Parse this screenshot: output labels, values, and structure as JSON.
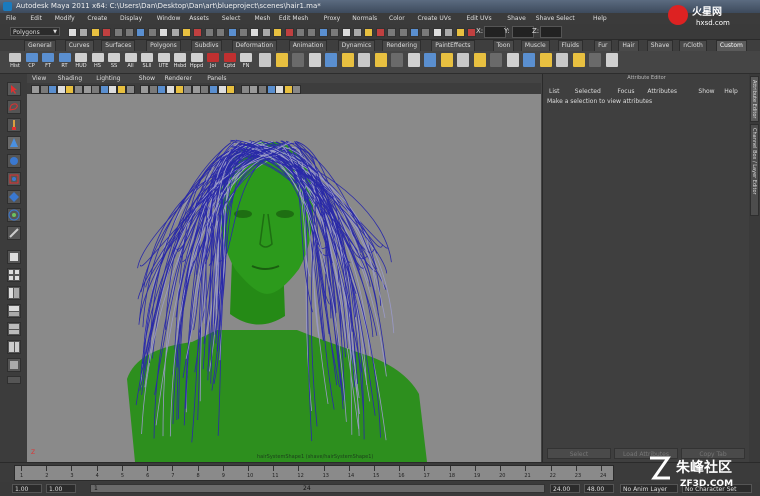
{
  "titlebar": {
    "title": "Autodesk Maya 2011 x64: C:\\Users\\Dan\\Desktop\\Dan\\art\\blueproject\\scenes\\hair1.ma*"
  },
  "menubar": [
    "File",
    "Edit",
    "Modify",
    "Create",
    "Display",
    "Window",
    "Assets",
    "Select",
    "Mesh",
    "Edit Mesh",
    "Proxy",
    "Normals",
    "Color",
    "Create UVs",
    "Edit UVs",
    "Shave",
    "Shave Select",
    "Help"
  ],
  "statusline": {
    "menuset": "Polygons",
    "coord_labels": [
      "X:",
      "Y:",
      "Z:"
    ]
  },
  "shelf_tabs": [
    "General",
    "Curves",
    "Surfaces",
    "Polygons",
    "Subdivs",
    "Deformation",
    "Animation",
    "Dynamics",
    "Rendering",
    "PaintEffects",
    "Toon",
    "Muscle",
    "Fluids",
    "Fur",
    "Hair",
    "Shave",
    "nCloth",
    "Custom"
  ],
  "shelf_tab_active": "Custom",
  "shelf_buttons": [
    {
      "label": "Hist",
      "color": "#c8c8c8"
    },
    {
      "label": "CP",
      "color": "#5a8fd0"
    },
    {
      "label": "FT",
      "color": "#5a8fd0"
    },
    {
      "label": "RT",
      "color": "#5a8fd0"
    },
    {
      "label": "HUD",
      "color": "#d0d0d0"
    },
    {
      "label": "HS",
      "color": "#d0d0d0"
    },
    {
      "label": "SS",
      "color": "#d0d0d0"
    },
    {
      "label": "All",
      "color": "#d0d0d0"
    },
    {
      "label": "SLII",
      "color": "#d0d0d0"
    },
    {
      "label": "UTE",
      "color": "#d0d0d0"
    },
    {
      "label": "Hsbd",
      "color": "#d0d0d0"
    },
    {
      "label": "Hppd",
      "color": "#d0d0d0"
    },
    {
      "label": "Joi",
      "color": "#c03030"
    },
    {
      "label": "Cptd",
      "color": "#c03030"
    },
    {
      "label": "FN",
      "color": "#d0d0d0"
    }
  ],
  "panel_menu": [
    "View",
    "Shading",
    "Lighting",
    "Show",
    "Renderer",
    "Panels"
  ],
  "viewport": {
    "bg": "#8a8a8a",
    "footer": "hairSystemShape1 (shave/hairSystemShape1)",
    "axis_label": "Z"
  },
  "attribute_editor": {
    "title": "Attribute Editor",
    "menu": [
      "List",
      "Selected",
      "Focus",
      "Attributes",
      "Show",
      "Help"
    ],
    "message": "Make a selection to view attributes",
    "buttons": [
      "Select",
      "Load Attributes",
      "Copy Tab"
    ]
  },
  "side_tabs": [
    "Attribute Editor",
    "Channel Box / Layer Editor"
  ],
  "timeline": {
    "ticks": [
      "1",
      "2",
      "3",
      "4",
      "5",
      "6",
      "7",
      "8",
      "9",
      "10",
      "11",
      "12",
      "13",
      "14",
      "15",
      "16",
      "17",
      "18",
      "19",
      "20",
      "21",
      "22",
      "23",
      "24"
    ]
  },
  "range": {
    "start_field": "1.00",
    "start_field2": "1.00",
    "current": "1",
    "range_end_label": "24",
    "end_field": "24.00",
    "end_field2": "48.00",
    "anim_layer": "No Anim Layer",
    "char_set": "No Character Set"
  },
  "watermarks": {
    "top": "hxsd.com",
    "top_brand": "火星网",
    "bottom_cn": "朱峰社区",
    "bottom": "ZF3D.COM"
  }
}
